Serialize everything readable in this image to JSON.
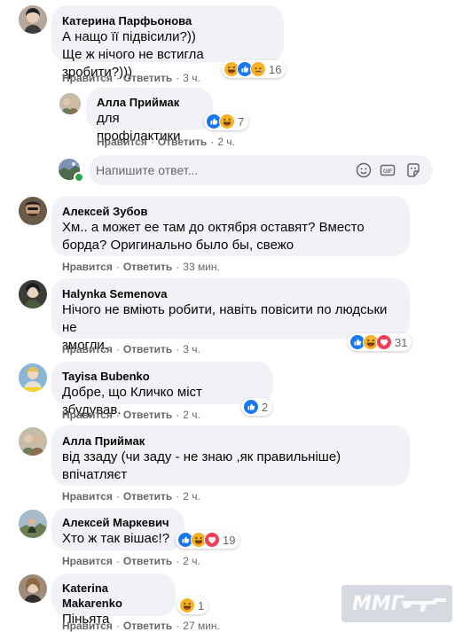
{
  "actions": {
    "like": "Нравится",
    "reply": "Ответить"
  },
  "reply_box": {
    "placeholder": "Напишите ответ..."
  },
  "colors": {
    "like": "#1877f2",
    "haha": "#f7b125",
    "love": "#f33e58",
    "sad": "#f7b125"
  },
  "comments": [
    {
      "author": "Катерина Парфьонова",
      "lines": [
        "А нащо її підвісили?))",
        "Ще ж нічого не встигла зробити?)))"
      ],
      "time": "3 ч.",
      "reactions": {
        "icons": [
          "haha-icon",
          "like-icon",
          "sad-icon"
        ],
        "count": "16"
      }
    },
    {
      "author": "Алла Приймак",
      "lines": [
        "для профілактики"
      ],
      "time": "2 ч.",
      "reactions": {
        "icons": [
          "like-icon",
          "haha-icon"
        ],
        "count": "7"
      }
    },
    {
      "author": "Алексей Зубов",
      "lines": [
        "Хм.. а может ее там до октября оставят? Вместо",
        "борда? Оригинально было бы, свежо"
      ],
      "time": "33 мин."
    },
    {
      "author": "Halynka Semenova",
      "lines": [
        "Нічого не вміють робити, навіть повісити по людськи не",
        "змогли."
      ],
      "time": "3 ч.",
      "reactions": {
        "icons": [
          "like-icon",
          "haha-icon",
          "love-icon"
        ],
        "count": "31"
      }
    },
    {
      "author": "Tayisa Bubenko",
      "lines": [
        "Добре, що Кличко міст збудував."
      ],
      "time": "2 ч.",
      "reactions": {
        "icons": [
          "like-icon"
        ],
        "count": "2"
      }
    },
    {
      "author": "Алла Приймак",
      "lines": [
        "від ззаду (чи заду - не знаю ,як правильніше)",
        "впічатляєт"
      ],
      "time": "2 ч."
    },
    {
      "author": "Алексей Маркевич",
      "lines": [
        "Хто ж так вішає!?"
      ],
      "time": "2 ч.",
      "reactions": {
        "icons": [
          "like-icon",
          "haha-icon",
          "love-icon"
        ],
        "count": "19"
      }
    },
    {
      "author": "Katerina Makarenko",
      "lines": [
        "Піньята"
      ],
      "time": "27 мин.",
      "reactions": {
        "icons": [
          "haha-icon"
        ],
        "count": "1"
      }
    }
  ],
  "watermark": "ММГ"
}
